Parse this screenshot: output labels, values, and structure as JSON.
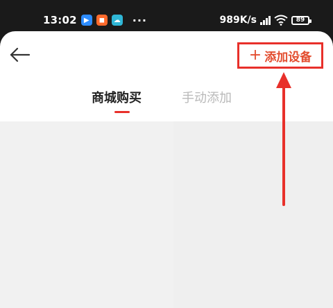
{
  "status_bar": {
    "time": "13:02",
    "app_icons": [
      "video-app-icon",
      "orange-app-icon",
      "cloud-app-icon"
    ],
    "more_indicator": "···",
    "network_speed": "989K/s",
    "battery": "89"
  },
  "header": {
    "back_icon": "arrow-left-icon",
    "add_device": {
      "plus": "+",
      "label": "添加设备"
    }
  },
  "tabs": [
    {
      "label": "商城购买",
      "active": true
    },
    {
      "label": "手动添加",
      "active": false
    }
  ],
  "colors": {
    "accent": "#e8302a",
    "add_text": "#e34d2f",
    "inactive_tab": "#b9b9b9",
    "content_bg": "#f1f1f1"
  }
}
